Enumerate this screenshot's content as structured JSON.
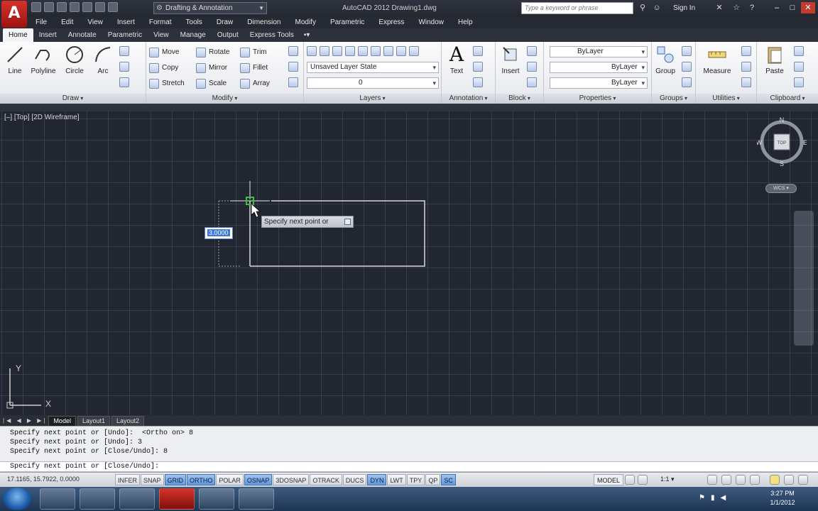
{
  "titlebar": {
    "logo_letter": "A",
    "workspace": "Drafting & Annotation",
    "title": "AutoCAD 2012    Drawing1.dwg",
    "search_placeholder": "Type a keyword or phrase",
    "signin": "Sign In",
    "minimize": "–",
    "maximize": "□",
    "close": "✕"
  },
  "menubar": [
    "File",
    "Edit",
    "View",
    "Insert",
    "Format",
    "Tools",
    "Draw",
    "Dimension",
    "Modify",
    "Parametric",
    "Express",
    "Window",
    "Help"
  ],
  "tabs": [
    "Home",
    "Insert",
    "Annotate",
    "Parametric",
    "View",
    "Manage",
    "Output",
    "Express Tools"
  ],
  "tabs_extra": "▪▾",
  "ribbon": {
    "draw": {
      "title": "Draw",
      "line": "Line",
      "polyline": "Polyline",
      "circle": "Circle",
      "arc": "Arc"
    },
    "modify": {
      "title": "Modify",
      "move": "Move",
      "rotate": "Rotate",
      "trim": "Trim",
      "copy": "Copy",
      "mirror": "Mirror",
      "fillet": "Fillet",
      "stretch": "Stretch",
      "scale": "Scale",
      "array": "Array"
    },
    "layers": {
      "title": "Layers",
      "layer_state": "Unsaved Layer State",
      "current_layer": "0"
    },
    "annotation": {
      "title": "Annotation",
      "text": "Text"
    },
    "block": {
      "title": "Block",
      "insert": "Insert"
    },
    "properties": {
      "title": "Properties",
      "color": "ByLayer",
      "linetype": "ByLayer",
      "lineweight": "ByLayer"
    },
    "groups": {
      "title": "Groups",
      "group": "Group"
    },
    "utilities": {
      "title": "Utilities",
      "measure": "Measure"
    },
    "clipboard": {
      "title": "Clipboard",
      "paste": "Paste"
    }
  },
  "viewport": {
    "label": "[–] [Top] [2D Wireframe]",
    "compass_n": "N",
    "compass_s": "S",
    "compass_e": "E",
    "compass_w": "W",
    "cube_face": "TOP",
    "wcs": "WCS ▾",
    "ucs_x": "X",
    "ucs_y": "Y"
  },
  "tooltip": "Specify next point or",
  "dynamic_input_value": "3.0000",
  "layout_tabs": [
    "Model",
    "Layout1",
    "Layout2"
  ],
  "layout_nav": "|◀ ◀ ▶ ▶|",
  "command_history": [
    "Specify next point or [Undo]:  <Ortho on> 8",
    "Specify next point or [Undo]: 3",
    "Specify next point or [Close/Undo]: 8"
  ],
  "command_line": "Specify next point or [Close/Undo]:",
  "status": {
    "coords": "17.1165, 15.7922, 0.0000",
    "toggles": [
      {
        "label": "INFER",
        "on": false
      },
      {
        "label": "SNAP",
        "on": false
      },
      {
        "label": "GRID",
        "on": true
      },
      {
        "label": "ORTHO",
        "on": true
      },
      {
        "label": "POLAR",
        "on": false
      },
      {
        "label": "OSNAP",
        "on": true
      },
      {
        "label": "3DOSNAP",
        "on": false
      },
      {
        "label": "OTRACK",
        "on": false
      },
      {
        "label": "DUCS",
        "on": false
      },
      {
        "label": "DYN",
        "on": true
      },
      {
        "label": "LWT",
        "on": false
      },
      {
        "label": "TPY",
        "on": false
      },
      {
        "label": "QP",
        "on": false
      },
      {
        "label": "SC",
        "on": true
      }
    ],
    "model": "MODEL",
    "scale": "1:1 ▾"
  },
  "taskbar": {
    "time": "3:27 PM",
    "date": "1/1/2012"
  },
  "colors": {
    "canvas_bg": "#212631",
    "grid": "#465062",
    "geometry": "#d9d9d9",
    "osnap_marker": "#3fbf3f",
    "toggle_on": "#5f97dd"
  }
}
